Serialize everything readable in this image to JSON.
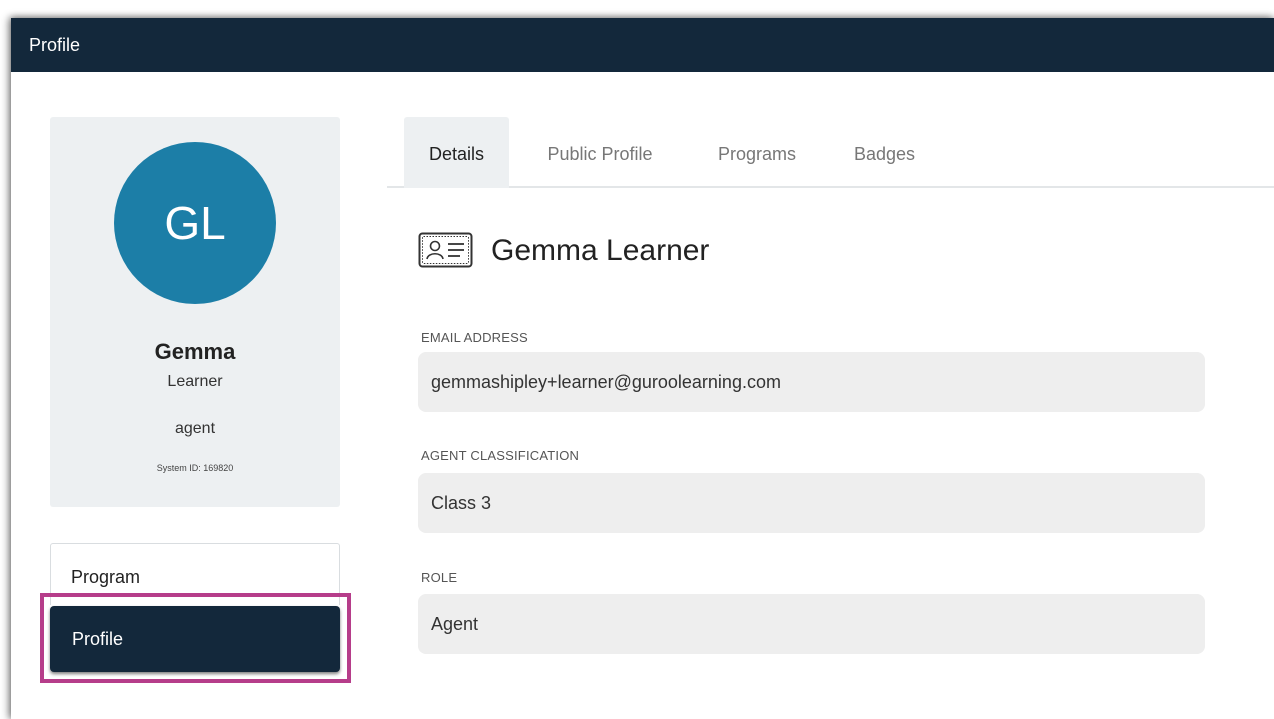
{
  "window": {
    "title": "Profile"
  },
  "profile_card": {
    "initials": "GL",
    "first_name": "Gemma",
    "last_name": "Learner",
    "role": "agent",
    "system_id": "System ID: 169820",
    "avatar_color": "#1c7ea7"
  },
  "nav": {
    "items": [
      {
        "label": "Program"
      },
      {
        "label": "Profile",
        "active": true
      }
    ]
  },
  "tabs": [
    {
      "label": "Details",
      "active": true
    },
    {
      "label": "Public Profile"
    },
    {
      "label": "Programs"
    },
    {
      "label": "Badges"
    }
  ],
  "details": {
    "full_name": "Gemma Learner",
    "name_icon": "id-card-icon",
    "fields": [
      {
        "label": "EMAIL ADDRESS",
        "value": "gemmashipley+learner@guroolearning.com"
      },
      {
        "label": "AGENT CLASSIFICATION",
        "value": "Class 3"
      },
      {
        "label": "ROLE",
        "value": "Agent"
      }
    ]
  },
  "colors": {
    "header_bg": "#13283b",
    "highlight": "#b63d8a"
  }
}
